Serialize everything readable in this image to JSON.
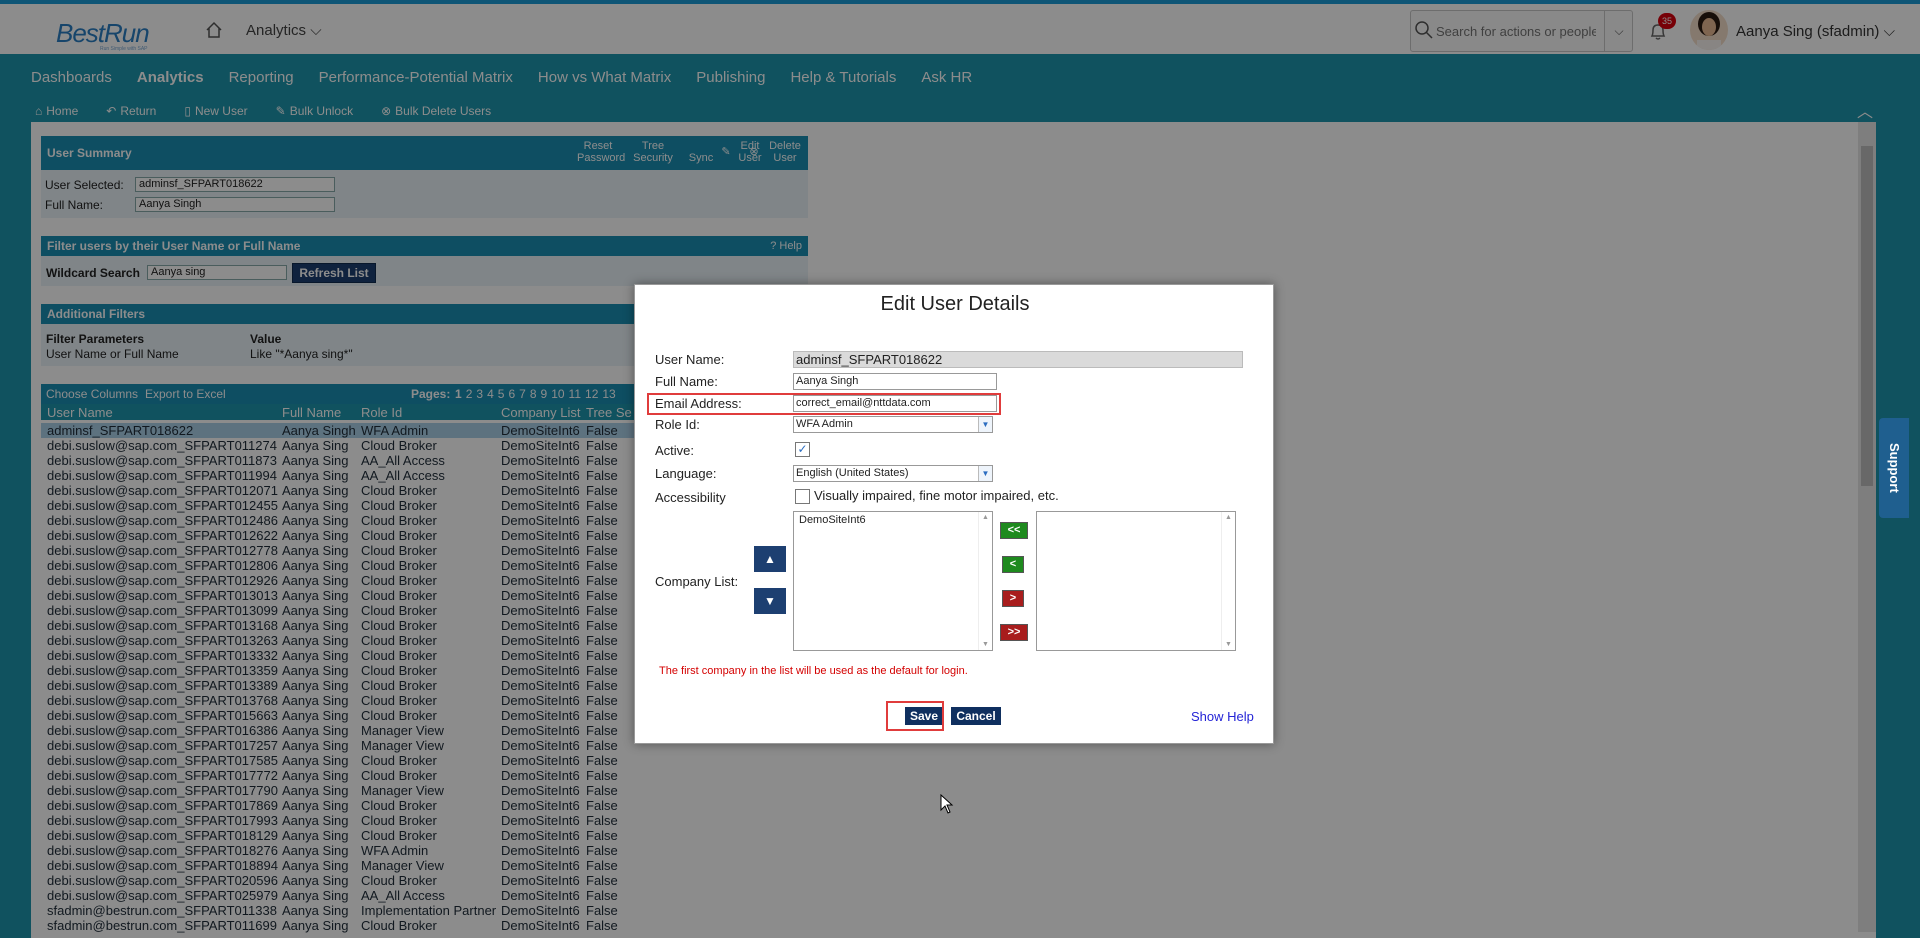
{
  "shell": {
    "logo": "BestRun",
    "logo_sub": "Run Simple with SAP",
    "module": "Analytics",
    "search_placeholder": "Search for actions or people",
    "notification_count": "35",
    "user": "Aanya Sing (sfadmin)"
  },
  "nav": [
    "Dashboards",
    "Analytics",
    "Reporting",
    "Performance-Potential Matrix",
    "How vs What Matrix",
    "Publishing",
    "Help & Tutorials",
    "Ask HR"
  ],
  "toolbar": {
    "home": "Home",
    "return": "Return",
    "new_user": "New User",
    "bulk_unlock": "Bulk Unlock",
    "bulk_delete": "Bulk Delete Users"
  },
  "summary": {
    "title": "User Summary",
    "reset_password": "Reset Password",
    "tree_security": "Tree Security",
    "sync": "Sync",
    "edit_user": "Edit User",
    "delete_user": "Delete User",
    "user_selected_label": "User Selected:",
    "user_selected_value": "adminsf_SFPART018622",
    "full_name_label": "Full Name:",
    "full_name_value": "Aanya Singh"
  },
  "filter": {
    "title": "Filter users by their User Name or Full Name",
    "help": "Help",
    "wildcard_label": "Wildcard Search",
    "wildcard_value": "Aanya sing",
    "refresh": "Refresh List"
  },
  "additional": {
    "title": "Additional Filters",
    "param_header": "Filter Parameters",
    "value_header": "Value",
    "param": "User Name or Full Name",
    "value": "Like \"*Aanya sing*\""
  },
  "table": {
    "choose_columns": "Choose Columns",
    "export": "Export to Excel",
    "pages_label": "Pages:",
    "pages": [
      "1",
      "2",
      "3",
      "4",
      "5",
      "6",
      "7",
      "8",
      "9",
      "10",
      "11",
      "12",
      "13"
    ],
    "columns": [
      "User Name",
      "Full Name",
      "Role Id",
      "Company List",
      "Tree Se"
    ],
    "rows": [
      [
        "adminsf_SFPART018622",
        "Aanya Singh",
        "WFA Admin",
        "DemoSiteInt6",
        "False"
      ],
      [
        "debi.suslow@sap.com_SFPART011274",
        "Aanya Sing",
        "Cloud Broker",
        "DemoSiteInt6",
        "False"
      ],
      [
        "debi.suslow@sap.com_SFPART011873",
        "Aanya Sing",
        "AA_All Access",
        "DemoSiteInt6",
        "False"
      ],
      [
        "debi.suslow@sap.com_SFPART011994",
        "Aanya Sing",
        "AA_All Access",
        "DemoSiteInt6",
        "False"
      ],
      [
        "debi.suslow@sap.com_SFPART012071",
        "Aanya Sing",
        "Cloud Broker",
        "DemoSiteInt6",
        "False"
      ],
      [
        "debi.suslow@sap.com_SFPART012455",
        "Aanya Sing",
        "Cloud Broker",
        "DemoSiteInt6",
        "False"
      ],
      [
        "debi.suslow@sap.com_SFPART012486",
        "Aanya Sing",
        "Cloud Broker",
        "DemoSiteInt6",
        "False"
      ],
      [
        "debi.suslow@sap.com_SFPART012622",
        "Aanya Sing",
        "Cloud Broker",
        "DemoSiteInt6",
        "False"
      ],
      [
        "debi.suslow@sap.com_SFPART012778",
        "Aanya Sing",
        "Cloud Broker",
        "DemoSiteInt6",
        "False"
      ],
      [
        "debi.suslow@sap.com_SFPART012806",
        "Aanya Sing",
        "Cloud Broker",
        "DemoSiteInt6",
        "False"
      ],
      [
        "debi.suslow@sap.com_SFPART012926",
        "Aanya Sing",
        "Cloud Broker",
        "DemoSiteInt6",
        "False"
      ],
      [
        "debi.suslow@sap.com_SFPART013013",
        "Aanya Sing",
        "Cloud Broker",
        "DemoSiteInt6",
        "False"
      ],
      [
        "debi.suslow@sap.com_SFPART013099",
        "Aanya Sing",
        "Cloud Broker",
        "DemoSiteInt6",
        "False"
      ],
      [
        "debi.suslow@sap.com_SFPART013168",
        "Aanya Sing",
        "Cloud Broker",
        "DemoSiteInt6",
        "False"
      ],
      [
        "debi.suslow@sap.com_SFPART013263",
        "Aanya Sing",
        "Cloud Broker",
        "DemoSiteInt6",
        "False"
      ],
      [
        "debi.suslow@sap.com_SFPART013332",
        "Aanya Sing",
        "Cloud Broker",
        "DemoSiteInt6",
        "False"
      ],
      [
        "debi.suslow@sap.com_SFPART013359",
        "Aanya Sing",
        "Cloud Broker",
        "DemoSiteInt6",
        "False"
      ],
      [
        "debi.suslow@sap.com_SFPART013389",
        "Aanya Sing",
        "Cloud Broker",
        "DemoSiteInt6",
        "False"
      ],
      [
        "debi.suslow@sap.com_SFPART013768",
        "Aanya Sing",
        "Cloud Broker",
        "DemoSiteInt6",
        "False"
      ],
      [
        "debi.suslow@sap.com_SFPART015663",
        "Aanya Sing",
        "Cloud Broker",
        "DemoSiteInt6",
        "False"
      ],
      [
        "debi.suslow@sap.com_SFPART016386",
        "Aanya Sing",
        "Manager View",
        "DemoSiteInt6",
        "False"
      ],
      [
        "debi.suslow@sap.com_SFPART017257",
        "Aanya Sing",
        "Manager View",
        "DemoSiteInt6",
        "False"
      ],
      [
        "debi.suslow@sap.com_SFPART017585",
        "Aanya Sing",
        "Cloud Broker",
        "DemoSiteInt6",
        "False"
      ],
      [
        "debi.suslow@sap.com_SFPART017772",
        "Aanya Sing",
        "Cloud Broker",
        "DemoSiteInt6",
        "False"
      ],
      [
        "debi.suslow@sap.com_SFPART017790",
        "Aanya Sing",
        "Manager View",
        "DemoSiteInt6",
        "False"
      ],
      [
        "debi.suslow@sap.com_SFPART017869",
        "Aanya Sing",
        "Cloud Broker",
        "DemoSiteInt6",
        "False"
      ],
      [
        "debi.suslow@sap.com_SFPART017993",
        "Aanya Sing",
        "Cloud Broker",
        "DemoSiteInt6",
        "False"
      ],
      [
        "debi.suslow@sap.com_SFPART018129",
        "Aanya Sing",
        "Cloud Broker",
        "DemoSiteInt6",
        "False"
      ],
      [
        "debi.suslow@sap.com_SFPART018276",
        "Aanya Sing",
        "WFA Admin",
        "DemoSiteInt6",
        "False"
      ],
      [
        "debi.suslow@sap.com_SFPART018894",
        "Aanya Sing",
        "Manager View",
        "DemoSiteInt6",
        "False"
      ],
      [
        "debi.suslow@sap.com_SFPART020596",
        "Aanya Sing",
        "Cloud Broker",
        "DemoSiteInt6",
        "False"
      ],
      [
        "debi.suslow@sap.com_SFPART025979",
        "Aanya Sing",
        "AA_All Access",
        "DemoSiteInt6",
        "False"
      ],
      [
        "sfadmin@bestrun.com_SFPART011338",
        "Aanya Sing",
        "Implementation Partner",
        "DemoSiteInt6",
        "False"
      ],
      [
        "sfadmin@bestrun.com_SFPART011699",
        "Aanya Sing",
        "Cloud Broker",
        "DemoSiteInt6",
        "False"
      ]
    ]
  },
  "modal": {
    "title": "Edit User Details",
    "user_name_label": "User Name:",
    "user_name_value": "adminsf_SFPART018622",
    "full_name_label": "Full Name:",
    "full_name_value": "Aanya Singh",
    "email_label": "Email Address:",
    "email_value": "correct_email@nttdata.com",
    "role_label": "Role Id:",
    "role_value": "WFA Admin",
    "active_label": "Active:",
    "language_label": "Language:",
    "language_value": "English (United States)",
    "accessibility_label": "Accessibility",
    "accessibility_option": "Visually impaired, fine motor impaired, etc.",
    "company_label": "Company List:",
    "company_selected": [
      "DemoSiteInt6"
    ],
    "move_all_left": "<<",
    "move_left": "<",
    "move_right": ">",
    "move_all_right": ">>",
    "note": "The first company in the list will be used as the default for login.",
    "save": "Save",
    "cancel": "Cancel",
    "show_help": "Show Help"
  },
  "support": "Support",
  "colors": {
    "accent": "#1e96ad",
    "dark_button": "#1d3f71",
    "highlight": "#e03c3c"
  }
}
